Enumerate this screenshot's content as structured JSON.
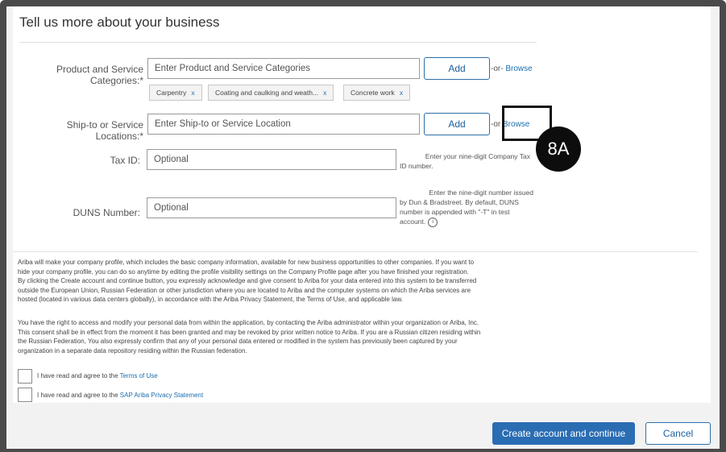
{
  "header": {
    "title": "Tell us more about your business"
  },
  "form": {
    "categories": {
      "label": "Product and Service Categories:*",
      "placeholder": "Enter Product and Service Categories",
      "add_label": "Add",
      "or_text": "-or-",
      "browse_label": "Browse",
      "chips": [
        {
          "label": "Carpentry",
          "remove": "x"
        },
        {
          "label": "Coating and caulking and weath...",
          "remove": "x"
        },
        {
          "label": "Concrete work",
          "remove": "x"
        }
      ]
    },
    "locations": {
      "label": "Ship-to or Service Locations:*",
      "placeholder": "Enter Ship-to or Service Location",
      "add_label": "Add",
      "or_text": "-or",
      "browse_label": "Browse"
    },
    "tax_id": {
      "label": "Tax ID:",
      "placeholder": "Optional",
      "hint_line1": "Enter your nine-digit Company Tax",
      "hint_line2": "ID number."
    },
    "duns": {
      "label": "DUNS Number:",
      "placeholder": "Optional",
      "hint_line1": "Enter the nine-digit number issued",
      "hint_line2": "by Dun & Bradstreet. By default, DUNS",
      "hint_line3": "number is appended with \"-T\" in test",
      "hint_line4": "account.",
      "info_icon": "i"
    }
  },
  "legal": {
    "para1": [
      "Ariba will make your company profile, which includes the basic company information, available for new business opportunities to other companies. If you want to",
      "hide your company profile, you can do so anytime by editing the profile visibility settings on the Company Profile page after you have finished your registration.",
      "By clicking the Create account and continue button, you expressly acknowledge and give consent to Ariba for your data entered into this system to be transferred",
      "outside the European Union, Russian Federation or other jurisdiction where you are located to Ariba and the computer systems on which the Ariba services are",
      "hosted (located in various data centers globally), in accordance with the Ariba Privacy Statement, the Terms of Use, and applicable law."
    ],
    "para2": [
      "You have the right to access and modify your personal data from within the application, by contacting the Ariba administrator within your organization or Ariba, Inc.",
      "This consent shall be in effect from the moment it has been granted and may be revoked by prior written notice to Ariba. If you are a Russian citizen residing within",
      "the Russian Federation, You also expressly confirm that any of your personal data entered or modified in the system has previously been captured by your",
      "organization in a separate data repository residing within the Russian federation."
    ],
    "terms_prefix": "I have read and agree to the",
    "terms_link": "Terms of Use",
    "privacy_prefix": "I have read and agree to the",
    "privacy_link": "SAP Ariba Privacy Statement"
  },
  "footer": {
    "create_label": "Create account and continue",
    "cancel_label": "Cancel"
  },
  "callout": {
    "label": "8A"
  },
  "colors": {
    "primary": "#2a6db3",
    "link": "#1a6fb0",
    "frame": "#4a4a4a"
  }
}
